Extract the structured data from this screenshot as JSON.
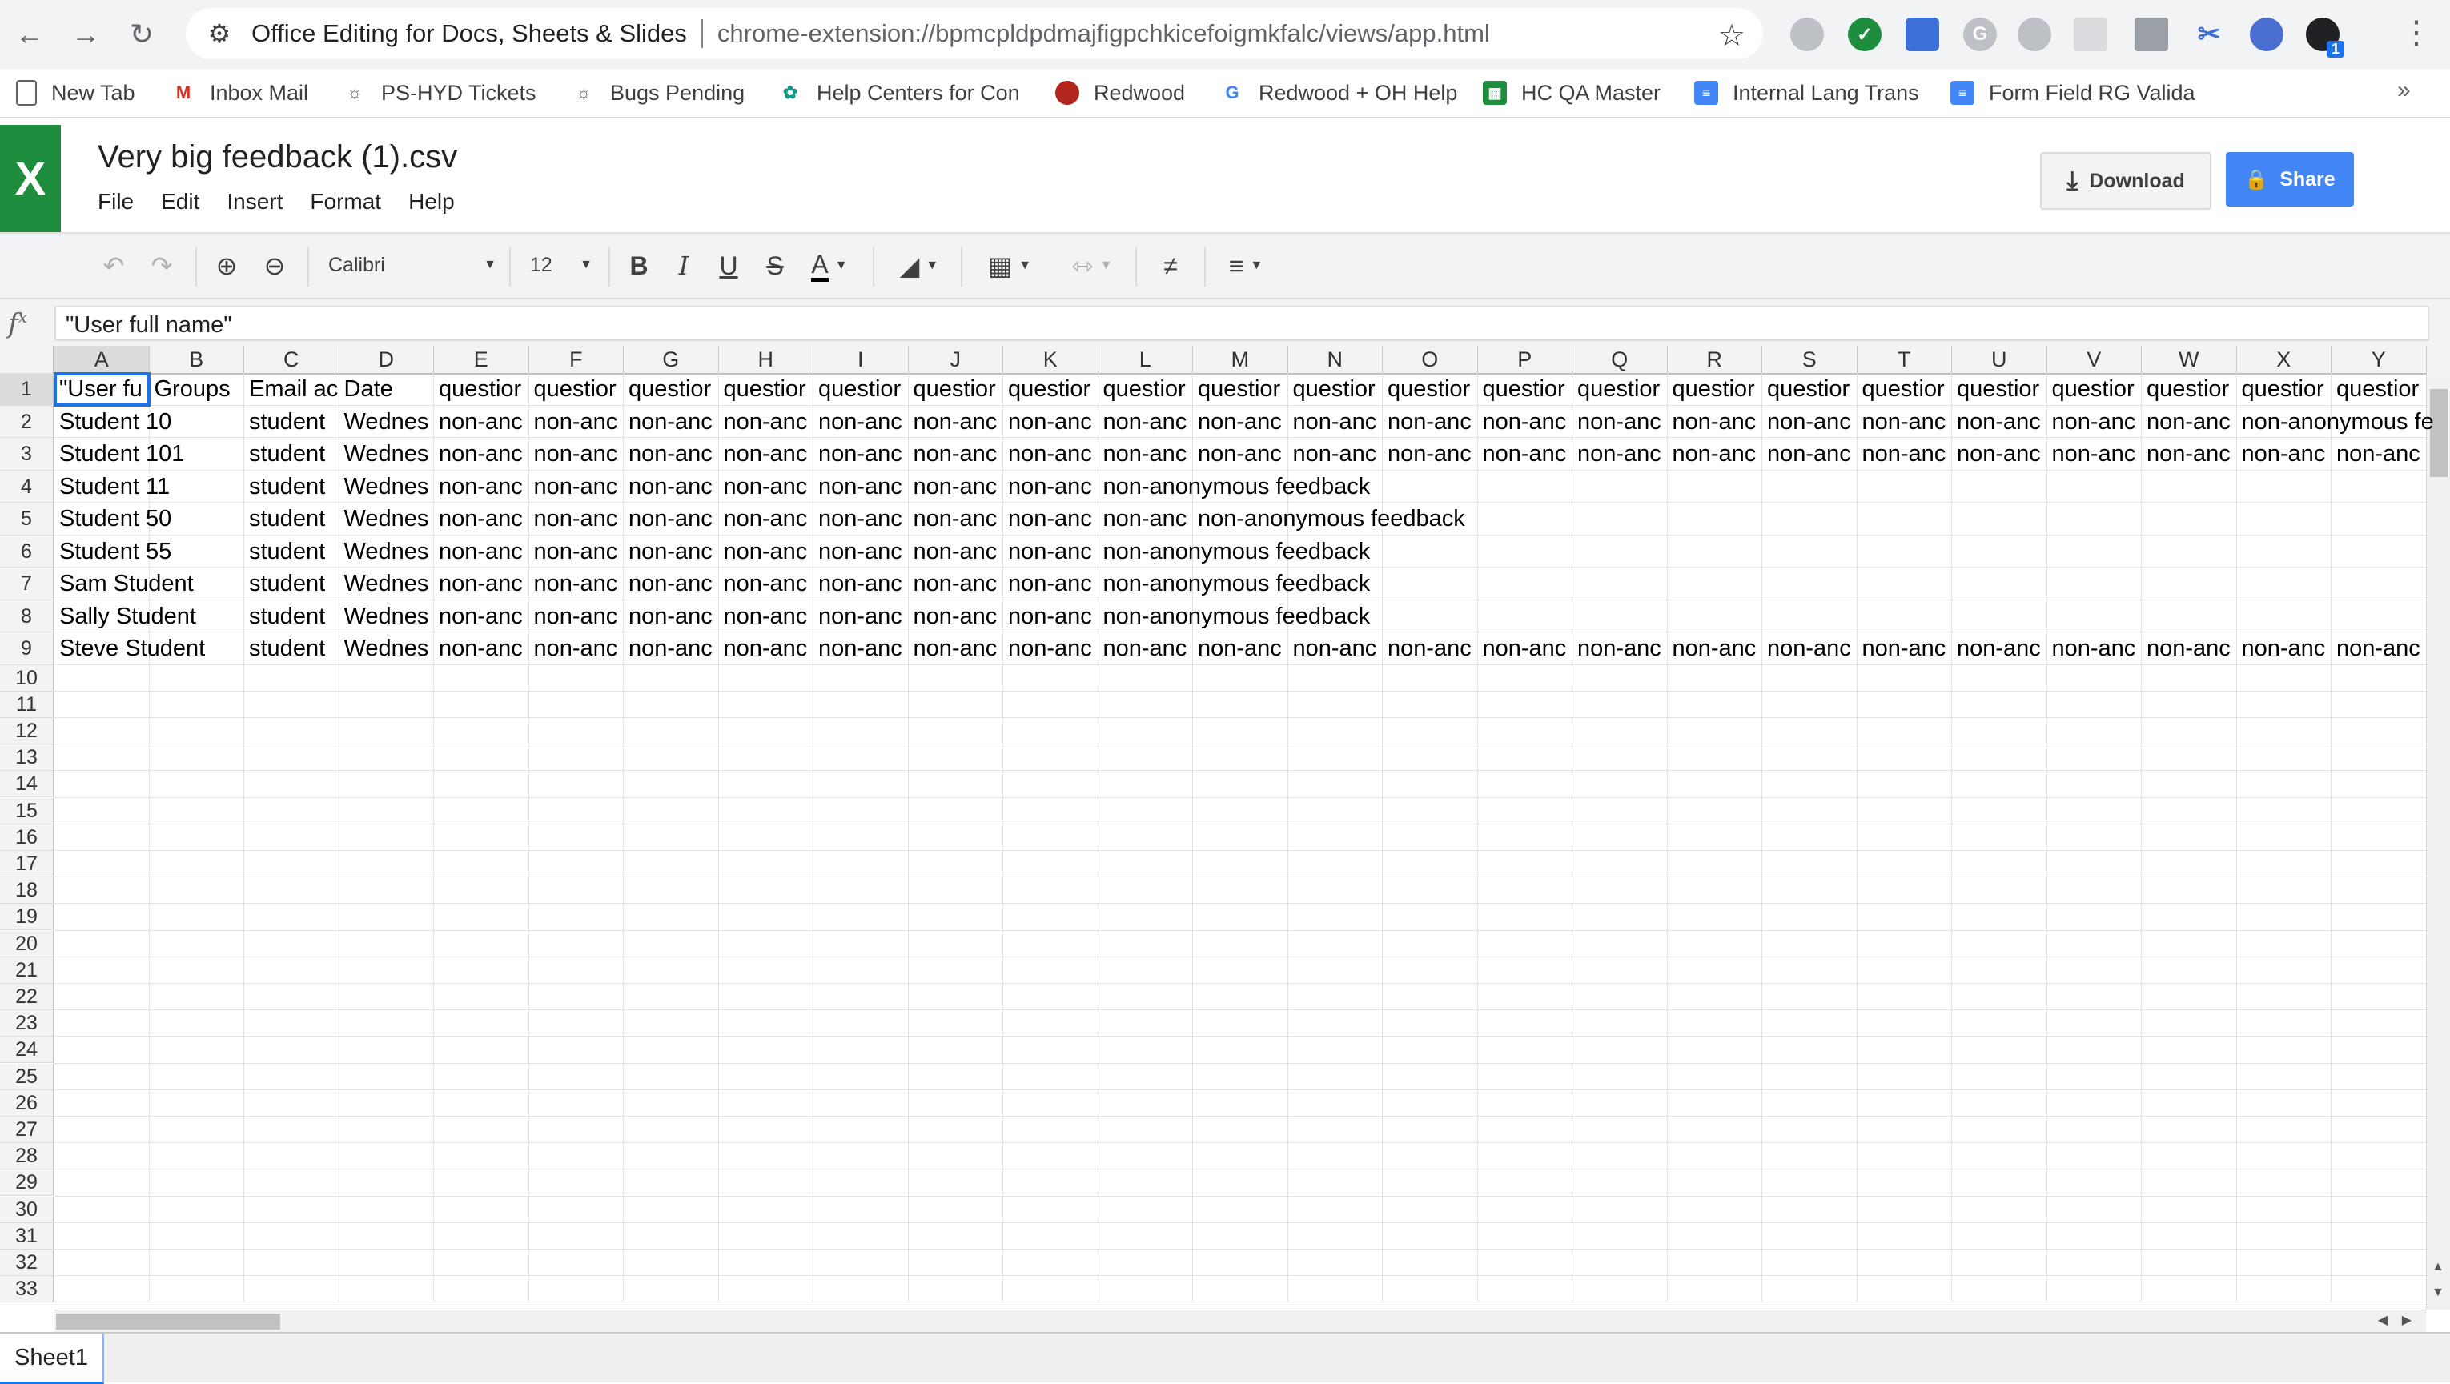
{
  "browser": {
    "site_name": "Office Editing for Docs, Sheets & Slides",
    "url": "chrome-extension://bpmcpldpdmajfigpchkicefoigmkfalc/views/app.html",
    "extension_badge": "1"
  },
  "bookmarks": [
    {
      "label": "New Tab",
      "icon": "page-icon"
    },
    {
      "label": "Inbox Mail",
      "icon": "gmail-icon"
    },
    {
      "label": "PS-HYD Tickets",
      "icon": "bug-icon"
    },
    {
      "label": "Bugs Pending",
      "icon": "bug-icon"
    },
    {
      "label": "Help Centers for Con",
      "icon": "leaf-icon"
    },
    {
      "label": "Redwood",
      "icon": "redwood-icon"
    },
    {
      "label": "Redwood + OH Help",
      "icon": "google-icon"
    },
    {
      "label": "HC QA Master",
      "icon": "sheets-icon"
    },
    {
      "label": "Internal Lang Trans",
      "icon": "docs-icon"
    },
    {
      "label": "Form Field RG Valida",
      "icon": "docs-icon"
    }
  ],
  "app": {
    "logo": "X",
    "title": "Very big feedback (1).csv",
    "menu": [
      "File",
      "Edit",
      "Insert",
      "Format",
      "Help"
    ],
    "download_label": "Download",
    "share_label": "Share"
  },
  "toolbar": {
    "font": "Calibri",
    "size": "12"
  },
  "formula_bar": {
    "fx": "f",
    "value": "\"User full name\""
  },
  "grid": {
    "columns": [
      "A",
      "B",
      "C",
      "D",
      "E",
      "F",
      "G",
      "H",
      "I",
      "J",
      "K",
      "L",
      "M",
      "N",
      "O",
      "P",
      "Q",
      "R",
      "S",
      "T",
      "U",
      "V",
      "W",
      "X",
      "Y"
    ],
    "row_numbers": [
      "1",
      "2",
      "3",
      "4",
      "5",
      "6",
      "7",
      "8",
      "9",
      "10",
      "11",
      "12",
      "13",
      "14",
      "15",
      "16",
      "17",
      "18",
      "19",
      "20",
      "21",
      "22",
      "23",
      "24",
      "25",
      "26",
      "27",
      "28",
      "29",
      "30",
      "31",
      "32",
      "33"
    ],
    "row1": [
      "\"User fu",
      "Groups",
      "Email ac",
      "Date",
      "questior",
      "questior",
      "questior",
      "questior",
      "questior",
      "questior",
      "questior",
      "questior",
      "questior",
      "questior",
      "questior",
      "questior",
      "questior",
      "questior",
      "questior",
      "questior",
      "questior",
      "questior",
      "questior",
      "questior",
      "questior"
    ],
    "names": [
      "Student 10",
      "Student 101",
      "Student 11",
      "Student 50",
      "Student 55",
      "Sam Student",
      "Sally Student",
      "Steve Student"
    ],
    "email_clip": "student",
    "date_clip": "Wednes",
    "answer_clip": "non-anc",
    "answer_full": "non-anonymous feedback",
    "row2_last": "non-anonymous fe"
  },
  "sheets": [
    "Sheet1"
  ]
}
